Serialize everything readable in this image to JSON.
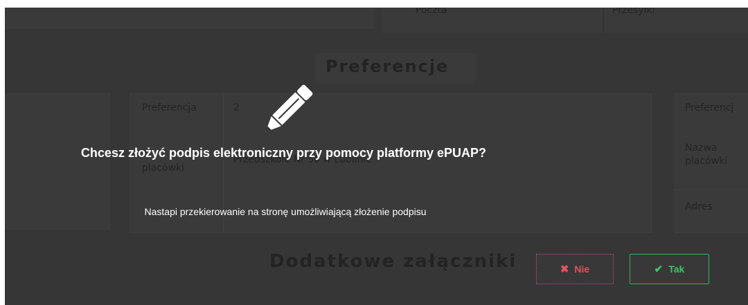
{
  "background": {
    "top_labels": [
      "Poczta",
      "Przesyłki"
    ],
    "section_heading": "Preferencje",
    "preference_card": {
      "label_preference": "Preferencja",
      "value_preference": "2",
      "label_facility": "placówki",
      "value_facility": "Przedszkole Nr 50 w Lublinie"
    },
    "right_card": {
      "label_preference": "Preferencj",
      "label_name": "Nazwa",
      "label_facility": "placówki",
      "label_address": "Adres"
    },
    "attachments_heading": "Dodatkowe załączniki"
  },
  "dialog": {
    "icon": "pencil-icon",
    "title": "Chcesz złożyć podpis elektroniczny przy pomocy platformy ePUAP?",
    "message": "Nastapi przekierowanie na stronę umożliwiającą złożenie podpisu",
    "buttons": {
      "no": {
        "label": "Nie",
        "icon": "x-icon",
        "color": "#e2535f"
      },
      "yes": {
        "label": "Tak",
        "icon": "check-icon",
        "color": "#3fc46a"
      }
    }
  },
  "colors": {
    "overlay": "#363636",
    "dialog_text": "#ffffff"
  }
}
